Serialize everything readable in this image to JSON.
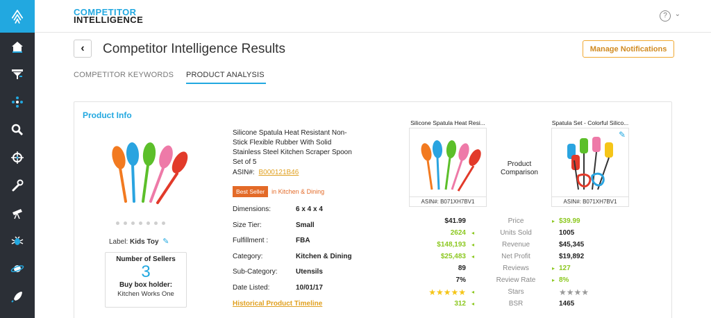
{
  "brand": {
    "line1": "COMPETITOR",
    "line2": "INTELLIGENCE"
  },
  "header": {
    "help_icon": "?",
    "chevron": "⌄"
  },
  "page": {
    "back_label": "‹",
    "title": "Competitor Intelligence Results",
    "manage_label": "Manage Notifications"
  },
  "tabs": [
    {
      "label": "COMPETITOR KEYWORDS"
    },
    {
      "label": "PRODUCT ANALYSIS"
    }
  ],
  "sidebar": {
    "icons": [
      "home-icon",
      "filter-icon",
      "network-icon",
      "search-icon",
      "target-icon",
      "wrench-icon",
      "telescope-icon",
      "bug-icon",
      "planet-icon",
      "rocket-icon"
    ]
  },
  "product": {
    "section_title": "Product Info",
    "title": "Silicone Spatula Heat Resistant Non-Stick Flexible Rubber With Solid Stainless Steel Kitchen Scraper Spoon Set of 5",
    "asin_label": "ASIN#:",
    "asin": "B000121B46",
    "best_seller_badge": "Best Seller",
    "best_seller_category": "in Kitchen & Dining",
    "label_key": "Label:",
    "label_value": "Kids Toy",
    "sellers_title": "Number of Sellers",
    "sellers_count": "3",
    "buybox_title": "Buy box holder:",
    "buybox_holder": "Kitchen Works One",
    "history_link": "Historical Product Timeline",
    "specs": [
      {
        "key": "Dimensions:",
        "value": "6 x 4 x 4"
      },
      {
        "key": "Size Tier:",
        "value": "Small"
      },
      {
        "key": "Fulfillment :",
        "value": "FBA"
      },
      {
        "key": "Category:",
        "value": "Kitchen & Dining"
      },
      {
        "key": "Sub-Category:",
        "value": "Utensils"
      },
      {
        "key": "Date Listed:",
        "value": "10/01/17"
      }
    ]
  },
  "comparison": {
    "left_title": "Silicone Spatula Heat Resi...",
    "left_asin": "ASIN#: B071XH7BV1",
    "mid_label_1": "Product",
    "mid_label_2": "Comparison",
    "right_title": "Spatula Set - Colorful Silico...",
    "right_asin": "ASIN#: B071XH7BV1",
    "rows": [
      {
        "left": "$41.99",
        "label": "Price",
        "right": "$39.99"
      },
      {
        "left": "2624",
        "label": "Units Sold",
        "right": "1005"
      },
      {
        "left": "$148,193",
        "label": "Revenue",
        "right": "$45,345"
      },
      {
        "left": "$25,483",
        "label": "Net Profit",
        "right": "$19,892"
      },
      {
        "left": "89",
        "label": "Reviews",
        "right": "127"
      },
      {
        "left": "7%",
        "label": "Review Rate",
        "right": "8%"
      },
      {
        "left": "★★★★★",
        "label": "Stars",
        "right": "★★★★"
      },
      {
        "left": "312",
        "label": "BSR",
        "right": "1465"
      }
    ],
    "stars_left_value": 4.5,
    "stars_right_value": 4
  },
  "colors": {
    "accent": "#22a8e0",
    "orange": "#f0a830",
    "green": "#8cc820",
    "sidebar": "#2b2f36"
  }
}
